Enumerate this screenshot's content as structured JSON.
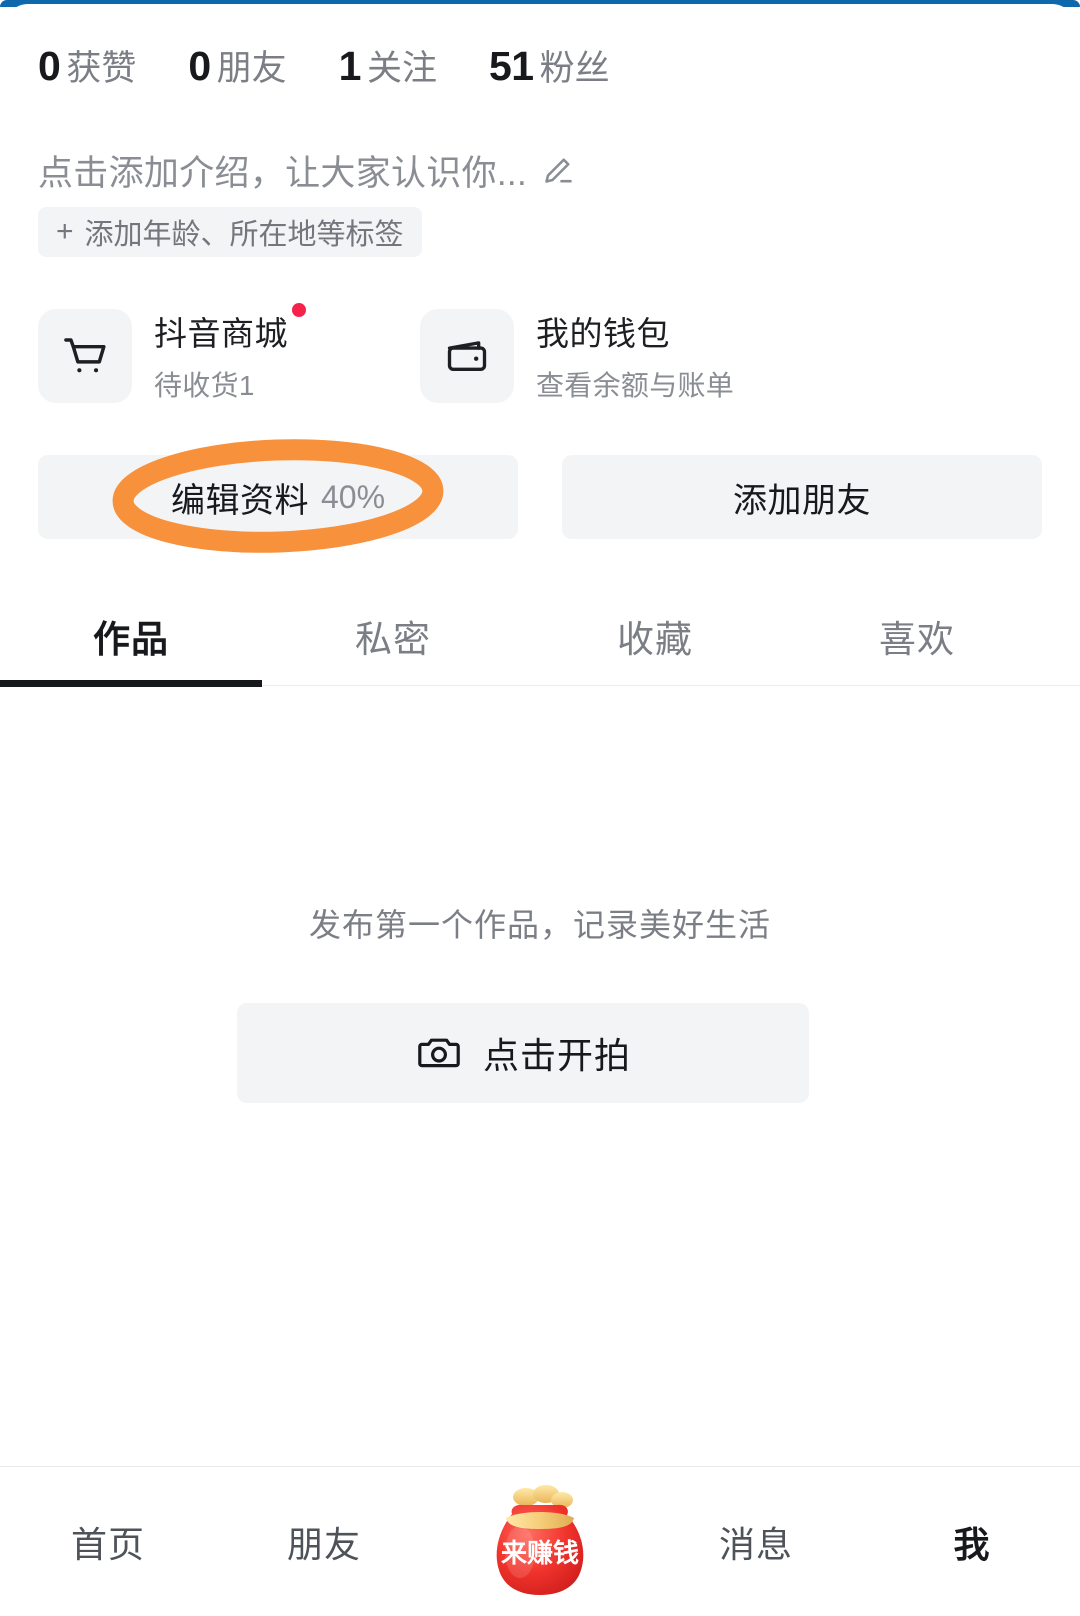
{
  "theme": {
    "accent_orange": "#f7913c",
    "badge_red": "#f5224b",
    "text_primary": "#18191c",
    "text_secondary": "#7b7f85",
    "chip_bg": "#f3f4f5",
    "top_edge_blue": "#1068ac"
  },
  "stats": [
    {
      "value": "0",
      "label": "获赞"
    },
    {
      "value": "0",
      "label": "朋友"
    },
    {
      "value": "1",
      "label": "关注"
    },
    {
      "value": "51",
      "label": "粉丝"
    }
  ],
  "bio": {
    "placeholder": "点击添加介绍，让大家认识你...",
    "edit_icon": "pencil-icon",
    "tag_plus": "+",
    "tag_label": "添加年龄、所在地等标签"
  },
  "entries": [
    {
      "icon": "shopping-cart-icon",
      "title": "抖音商城",
      "subtitle": "待收货1",
      "badge": "red-dot"
    },
    {
      "icon": "wallet-icon",
      "title": "我的钱包",
      "subtitle": "查看余额与账单",
      "badge": ""
    }
  ],
  "actions": {
    "edit_profile_label": "编辑资料",
    "edit_profile_percent": "40%",
    "add_friend_label": "添加朋友",
    "annotation": "orange-ellipse-highlight"
  },
  "tabs": [
    {
      "label": "作品",
      "active": true
    },
    {
      "label": "私密",
      "active": false
    },
    {
      "label": "收藏",
      "active": false
    },
    {
      "label": "喜欢",
      "active": false
    }
  ],
  "empty_state": {
    "message": "发布第一个作品，记录美好生活",
    "button_label": "点击开拍",
    "button_icon": "camera-icon"
  },
  "bottom_nav": [
    {
      "label": "首页",
      "active": false,
      "icon": ""
    },
    {
      "label": "朋友",
      "active": false,
      "icon": ""
    },
    {
      "label": "来赚钱",
      "active": false,
      "icon": "money-bag-icon"
    },
    {
      "label": "消息",
      "active": false,
      "icon": ""
    },
    {
      "label": "我",
      "active": true,
      "icon": ""
    }
  ]
}
